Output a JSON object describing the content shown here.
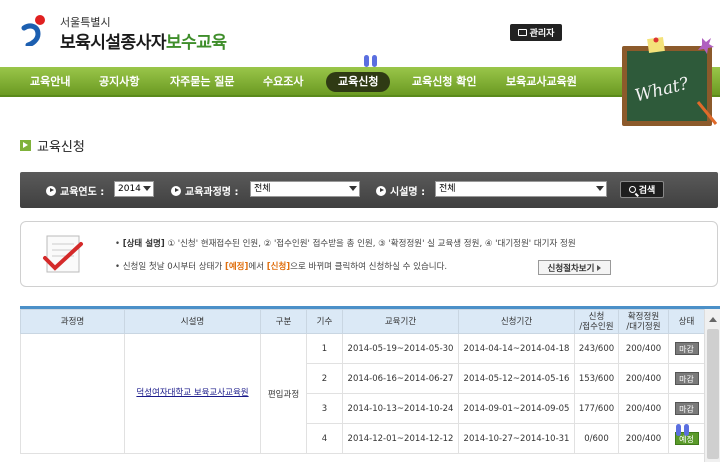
{
  "header": {
    "logo_city": "서울특별시",
    "logo_title_black": "보육시설종사자",
    "logo_title_green": "보수교육",
    "admin_label": "관리자"
  },
  "nav": {
    "items": [
      {
        "label": "교육안내"
      },
      {
        "label": "공지사항"
      },
      {
        "label": "자주묻는 질문"
      },
      {
        "label": "수요조사"
      },
      {
        "label": "교육신청",
        "active": true
      },
      {
        "label": "교육신청 확인"
      },
      {
        "label": "보육교사교육원"
      }
    ]
  },
  "page": {
    "title": "교육신청"
  },
  "filter": {
    "year_label": "교육연도 :",
    "year_value": "2014",
    "course_label": "교육과정명 :",
    "course_value": "전체",
    "facility_label": "시설명 :",
    "facility_value": "전체",
    "search_label": "검색"
  },
  "info": {
    "line1_bold": "[상태 설명]",
    "line1_text": "① '신청' 현재접수된 인원, ② '접수인원' 접수받을 총 인원, ③ '확정정원' 실 교육생 정원, ④ '대기정원' 대기자 정원",
    "line2_a": "신청일 첫날 0시부터 상태가 ",
    "line2_b": "[예정]",
    "line2_c": "에서 ",
    "line2_d": "[신청]",
    "line2_e": "으로 바뀌며 클릭하여 신청하실 수 있습니다.",
    "status_button": "신청절차보기"
  },
  "table": {
    "headers": [
      "과정명",
      "시설명",
      "구분",
      "기수",
      "교육기간",
      "신청기간",
      "신청\n/접수인원",
      "확정정원\n/대기정원",
      "상태"
    ],
    "facility": "덕성여자대학교 보육교사교육원",
    "category": "편입과정",
    "rows": [
      {
        "no": "1",
        "edu": "2014-05-19~2014-05-30",
        "apply": "2014-04-14~2014-04-18",
        "count": "243/600",
        "quota": "200/400",
        "status": "마감"
      },
      {
        "no": "2",
        "edu": "2014-06-16~2014-06-27",
        "apply": "2014-05-12~2014-05-16",
        "count": "153/600",
        "quota": "200/400",
        "status": "마감"
      },
      {
        "no": "3",
        "edu": "2014-10-13~2014-10-24",
        "apply": "2014-09-01~2014-09-05",
        "count": "177/600",
        "quota": "200/400",
        "status": "마감"
      },
      {
        "no": "4",
        "edu": "2014-12-01~2014-12-12",
        "apply": "2014-10-27~2014-10-31",
        "count": "0/600",
        "quota": "200/400",
        "status": "예정"
      }
    ]
  },
  "colors": {
    "nav_green": "#7fb23a",
    "nav_active": "#2f3a14",
    "table_header": "#dbe9f6",
    "accent_orange": "#e07010"
  },
  "board_text": "What?"
}
